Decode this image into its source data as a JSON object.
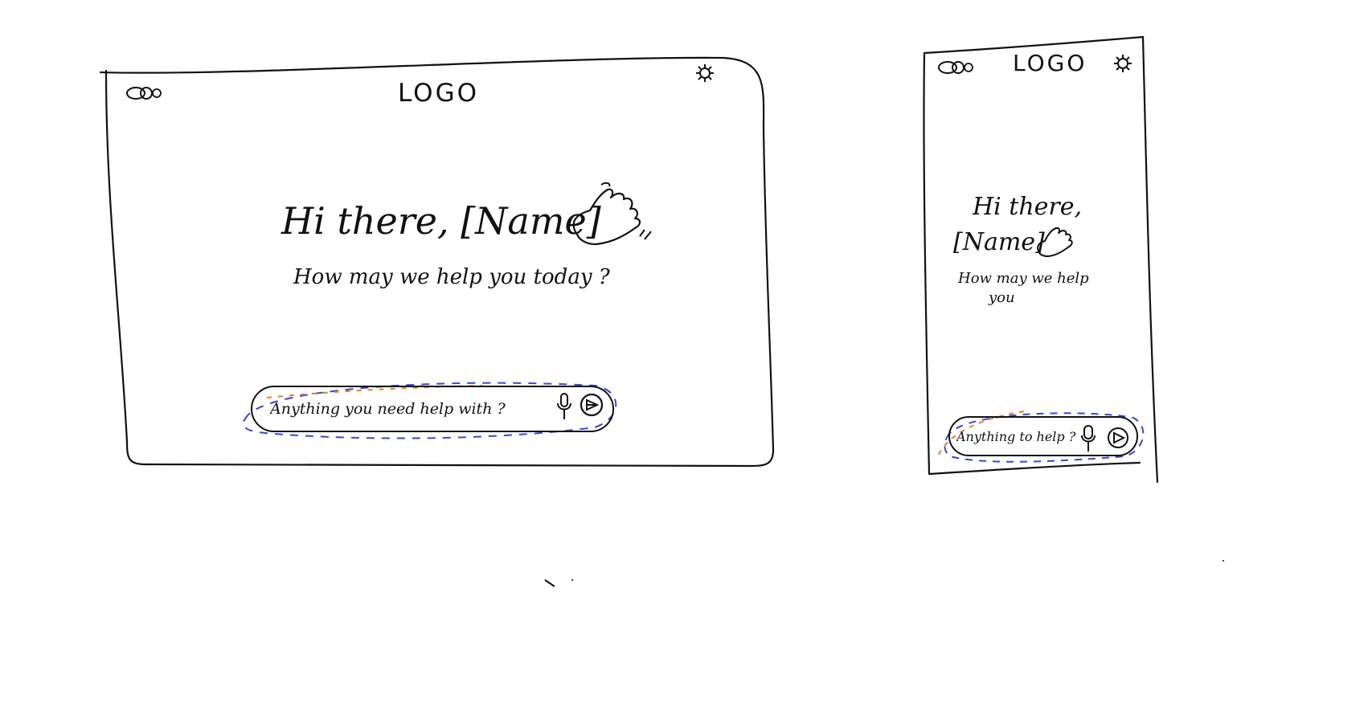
{
  "desktop": {
    "header": {
      "logo": "LOGO",
      "left_icon": "settings-toggle-icon",
      "right_icon": "gear-icon"
    },
    "greeting": {
      "title": "Hi there, [Name]",
      "wave_icon": "waving-hand-icon"
    },
    "subtitle": "How may we help you today ?",
    "chat": {
      "placeholder": "Anything you need help with ?",
      "mic_icon": "microphone-icon",
      "send_icon": "send-icon"
    }
  },
  "mobile": {
    "header": {
      "logo": "LOGO",
      "left_icon": "settings-toggle-icon",
      "right_icon": "gear-icon"
    },
    "greeting": {
      "line1": "Hi there,",
      "line2": "[Name]",
      "wave_icon": "waving-hand-icon"
    },
    "subtitle": {
      "line1": "How may we help",
      "line2": "you"
    },
    "chat": {
      "placeholder": "Anything to help ?",
      "mic_icon": "microphone-icon",
      "send_icon": "send-icon"
    }
  },
  "colors": {
    "ink": "#111111",
    "highlight_orange": "#f07a1e",
    "highlight_blue": "#3a45d8"
  }
}
